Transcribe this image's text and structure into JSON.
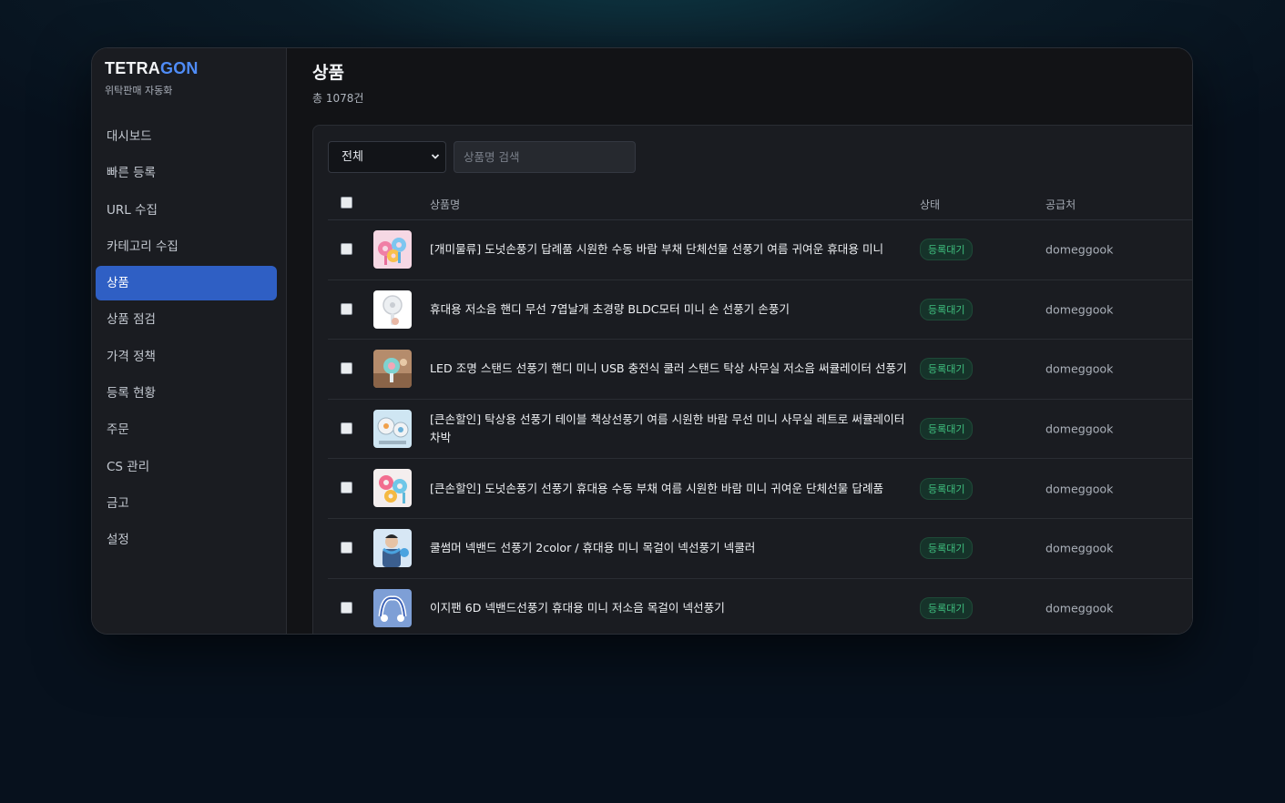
{
  "brand": {
    "name_part1": "TETRA",
    "name_part2": "GON",
    "subtitle": "위탁판매 자동화",
    "accent_color": "#4f8cf7"
  },
  "sidebar": {
    "items": [
      {
        "label": "대시보드",
        "active": false
      },
      {
        "label": "빠른 등록",
        "active": false
      },
      {
        "label": "URL 수집",
        "active": false
      },
      {
        "label": "카테고리 수집",
        "active": false
      },
      {
        "label": "상품",
        "active": true
      },
      {
        "label": "상품 점검",
        "active": false
      },
      {
        "label": "가격 정책",
        "active": false
      },
      {
        "label": "등록 현황",
        "active": false
      },
      {
        "label": "주문",
        "active": false
      },
      {
        "label": "CS 관리",
        "active": false
      },
      {
        "label": "금고",
        "active": false
      },
      {
        "label": "설정",
        "active": false
      }
    ]
  },
  "page": {
    "title": "상품",
    "count": "총 1078건"
  },
  "filters": {
    "status_selected": "전체",
    "search_placeholder": "상품명 검색"
  },
  "table": {
    "headers": {
      "name": "상품명",
      "status": "상태",
      "supplier": "공급처"
    },
    "rows": [
      {
        "name": "[개미물류] 도넛손풍기 답례품 시원한 수동 바람 부채 단체선물 선풍기 여름 귀여운 휴대용 미니",
        "status": "등록대기",
        "supplier": "domeggook",
        "thumb": "donut-fan"
      },
      {
        "name": "휴대용 저소음 핸디 무선 7엽날개 초경량 BLDC모터 미니 손 선풍기 손풍기",
        "status": "등록대기",
        "supplier": "domeggook",
        "thumb": "handy-fan"
      },
      {
        "name": "LED 조명 스탠드 선풍기 핸디 미니 USB 충전식 쿨러 스탠드 탁상 사무실 저소음 써큘레이터 선풍기",
        "status": "등록대기",
        "supplier": "domeggook",
        "thumb": "led-fan"
      },
      {
        "name": "[큰손할인] 탁상용 선풍기 테이블 책상선풍기 여름 시원한 바람 무선 미니 사무실 레트로 써큘레이터 차박",
        "status": "등록대기",
        "supplier": "domeggook",
        "thumb": "desk-fan"
      },
      {
        "name": "[큰손할인] 도넛손풍기 선풍기 휴대용 수동 부채 여름 시원한 바람 미니 귀여운 단체선물 답례품",
        "status": "등록대기",
        "supplier": "domeggook",
        "thumb": "donut-fan-2"
      },
      {
        "name": "쿨썸머 넥밴드 선풍기 2color / 휴대용 미니 목걸이 넥선풍기 넥쿨러",
        "status": "등록대기",
        "supplier": "domeggook",
        "thumb": "neck-fan"
      },
      {
        "name": "이지팬 6D 넥밴드선풍기 휴대용 미니 저소음 목걸이 넥선풍기",
        "status": "등록대기",
        "supplier": "domeggook",
        "thumb": "neckband-fan"
      }
    ]
  },
  "colors": {
    "active_nav": "#2f5fc4",
    "status_badge_text": "#3fbf7f",
    "status_badge_bg": "#16332a"
  }
}
